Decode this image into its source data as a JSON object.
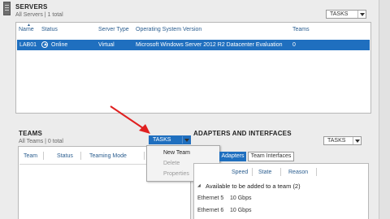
{
  "servers": {
    "title": "SERVERS",
    "subtitle": "All Servers | 1 total",
    "tasks_label": "TASKS",
    "columns": [
      "Name",
      "Status",
      "Server Type",
      "Operating System Version",
      "Teams"
    ],
    "rows": [
      {
        "name": "LAB01",
        "status": "Online",
        "server_type": "Virtual",
        "os": "Microsoft Windows Server 2012 R2 Datacenter Evaluation",
        "teams": "0"
      }
    ]
  },
  "teams": {
    "title": "TEAMS",
    "subtitle": "All Teams | 0 total",
    "tasks_label": "TASKS",
    "columns": [
      "Team",
      "Status",
      "Teaming Mode"
    ],
    "menu": [
      {
        "label": "New Team",
        "enabled": true
      },
      {
        "label": "Delete",
        "enabled": false
      },
      {
        "label": "Properties",
        "enabled": false
      }
    ]
  },
  "adapters": {
    "title": "ADAPTERS AND INTERFACES",
    "tasks_label": "TASKS",
    "tabs": [
      "Adapters",
      "Team Interfaces"
    ],
    "columns": [
      "Speed",
      "State",
      "Reason"
    ],
    "group_label": "Available to be added to a team (2)",
    "rows": [
      {
        "name": "Ethernet 5",
        "speed": "10 Gbps"
      },
      {
        "name": "Ethernet 6",
        "speed": "10 Gbps"
      }
    ]
  },
  "colors": {
    "accent": "#1f6fbf",
    "arrow": "#e02020",
    "header_text": "#2a5d8f"
  }
}
